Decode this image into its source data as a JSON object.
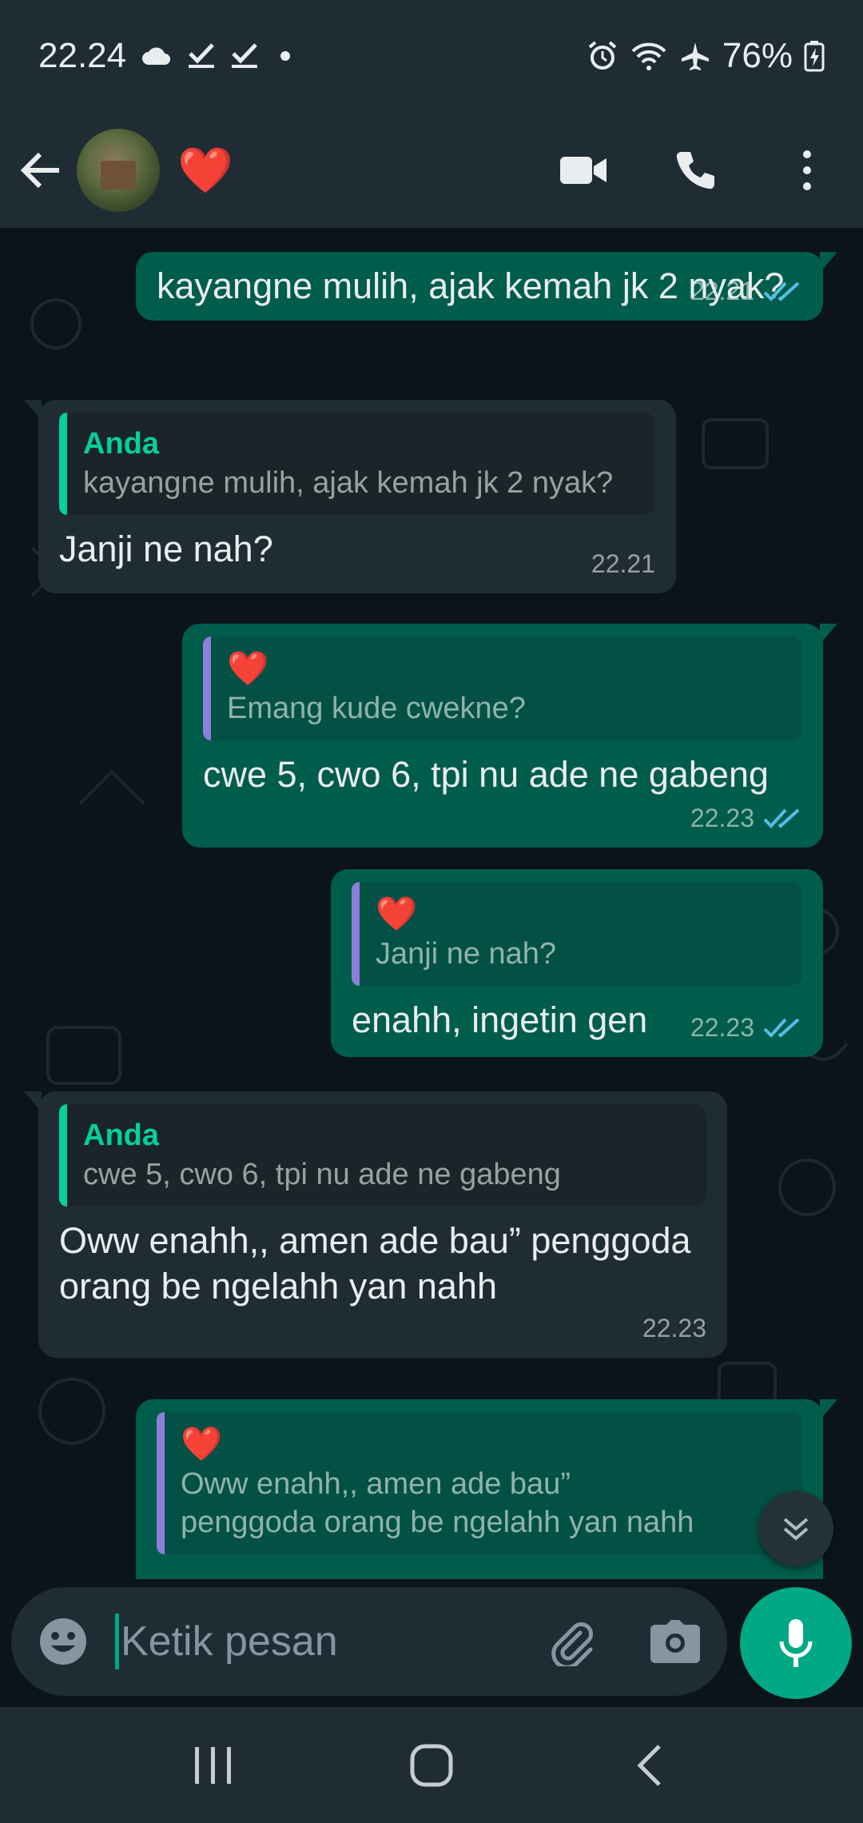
{
  "status_bar": {
    "time": "22.24",
    "battery": "76%",
    "left_icons": [
      "cloud-icon",
      "check-icon",
      "check-icon",
      "dot-icon"
    ],
    "right_icons": [
      "alarm-icon",
      "wifi-icon",
      "airplane-icon",
      "battery-charging-icon"
    ]
  },
  "header": {
    "contact_name": "❤️",
    "actions": [
      "video-call-icon",
      "voice-call-icon",
      "more-options-icon"
    ]
  },
  "messages": [
    {
      "direction": "out",
      "text": "kayangne mulih, ajak kemah jk 2 nyak?",
      "time": "22.21",
      "status": "read"
    },
    {
      "direction": "in",
      "quote_author": "Anda",
      "quote_text": "kayangne mulih, ajak kemah jk 2 nyak?",
      "text": "Janji ne nah?",
      "time": "22.21"
    },
    {
      "direction": "out",
      "quote_author": "❤️",
      "quote_text": "Emang kude cwekne?",
      "text": "cwe 5, cwo 6, tpi nu ade ne gabeng",
      "time": "22.23",
      "status": "read"
    },
    {
      "direction": "out",
      "quote_author": "❤️",
      "quote_text": "Janji ne nah?",
      "text": "enahh, ingetin gen",
      "time": "22.23",
      "status": "read"
    },
    {
      "direction": "in",
      "quote_author": "Anda",
      "quote_text": "cwe 5, cwo 6, tpi nu ade ne gabeng",
      "text": "Oww enahh,, amen ade bau” penggoda orang be ngelahh yan nahh",
      "time": "22.23"
    },
    {
      "direction": "out",
      "quote_author": "❤️",
      "quote_text": "Oww enahh,, amen ade bau” penggoda orang be ngelahh yan nahh",
      "text": "",
      "time": ""
    }
  ],
  "composer": {
    "placeholder": "Ketik pesan"
  },
  "colors": {
    "outgoing_bubble": "#005c4b",
    "incoming_bubble": "#202c33",
    "accent": "#00a884",
    "read_ticks": "#53bdeb",
    "heart": "#e53935"
  }
}
